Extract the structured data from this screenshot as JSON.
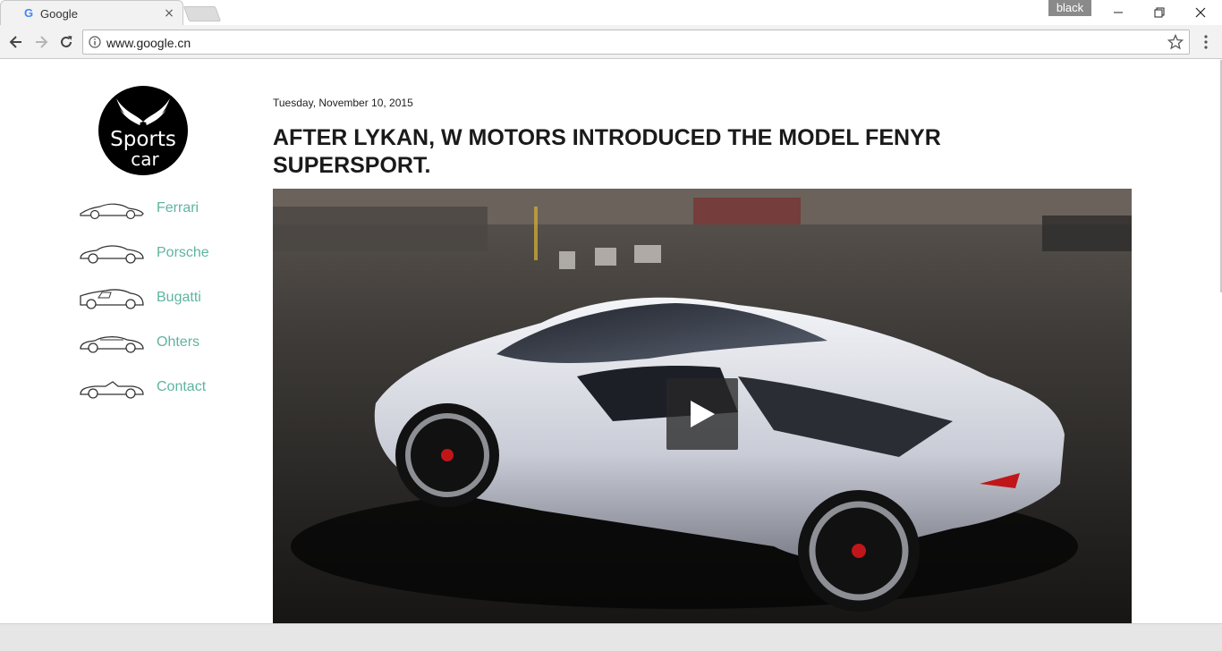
{
  "browser": {
    "tab": {
      "title": "Google",
      "favicon": "G",
      "close": "×"
    },
    "profile_badge": "black",
    "address": {
      "url": "www.google.cn"
    },
    "icons": {
      "back": "back-arrow-icon",
      "forward": "forward-arrow-icon",
      "reload": "reload-icon",
      "info": "info-icon",
      "bookmark": "star-icon",
      "menu": "kebab-menu-icon"
    }
  },
  "site": {
    "logo": {
      "line1": "Sports",
      "line2": "car"
    },
    "nav": [
      {
        "label": "Ferrari",
        "icon": "car-ferrari-icon"
      },
      {
        "label": "Porsche",
        "icon": "car-porsche-icon"
      },
      {
        "label": "Bugatti",
        "icon": "car-bugatti-icon"
      },
      {
        "label": "Ohters",
        "icon": "car-others-icon"
      },
      {
        "label": "Contact",
        "icon": "car-convertible-icon"
      }
    ],
    "accent_color": "#5fb4a0"
  },
  "post": {
    "date": "Tuesday, November 10, 2015",
    "title": "AFTER LYKAN, W MOTORS INTRODUCED THE MODEL FENYR SUPERSPORT.",
    "video": {
      "play_icon": "play-icon"
    }
  }
}
